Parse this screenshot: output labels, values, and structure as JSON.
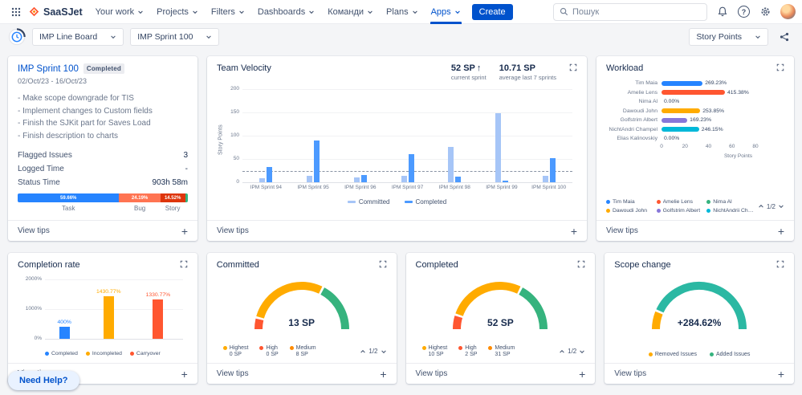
{
  "topnav": {
    "logo_text": "SaaSJet",
    "items": [
      {
        "label": "Your work",
        "active": false
      },
      {
        "label": "Projects",
        "active": false
      },
      {
        "label": "Filters",
        "active": false
      },
      {
        "label": "Dashboards",
        "active": false
      },
      {
        "label": "Команди",
        "active": false
      },
      {
        "label": "Plans",
        "active": false
      },
      {
        "label": "Apps",
        "active": true
      }
    ],
    "create_label": "Create",
    "search_placeholder": "Пошук",
    "help_glyph": "?"
  },
  "toolbar": {
    "board_select": "IMP Line Board",
    "sprint_select": "IMP Sprint 100",
    "metric_select": "Story Points"
  },
  "labels": {
    "view_tips": "View tips",
    "plus": "+",
    "need_help": "Need Help?"
  },
  "cards": {
    "sprint": {
      "title": "IMP Sprint 100",
      "badge": "Completed",
      "dates": "02/Oct/23 - 16/Oct/23",
      "goals": [
        "- Make scope downgrade for TIS",
        "- Implement changes to Custom fields",
        "- Finish the SJKit part for Saves Load",
        "- Finish description to charts"
      ],
      "stats": [
        {
          "label": "Flagged Issues",
          "value": "3"
        },
        {
          "label": "Logged Time",
          "value": "-"
        },
        {
          "label": "Status Time",
          "value": "903h 58m"
        }
      ],
      "type_bar": {
        "segments": [
          {
            "label": "59.66%",
            "value": 59.66,
            "color": "#2684FF"
          },
          {
            "label": "24.19%",
            "value": 24.19,
            "color": "#FF7452"
          },
          {
            "label": "14.52%",
            "value": 14.52,
            "color": "#DE350B"
          },
          {
            "label": "",
            "value": 1.63,
            "color": "#36B37E"
          }
        ],
        "type_labels": [
          "Task",
          "Bug",
          "Story"
        ]
      }
    },
    "velocity": {
      "title": "Team Velocity",
      "current": {
        "value": "52 SP",
        "arrow": "↑",
        "caption": "current sprint"
      },
      "average": {
        "value": "10.71 SP",
        "caption": "average last 7 sprints"
      },
      "chart_data": {
        "type": "bar",
        "categories": [
          "IPM Sprint 94",
          "IPM Sprint 95",
          "IPM Sprint 96",
          "IPM Sprint 97",
          "IPM Sprint 98",
          "IPM Sprint 99",
          "IPM Sprint 100"
        ],
        "series": [
          {
            "name": "Committed",
            "color": "#A6C5F7",
            "values": [
              8,
              13,
              10,
              13,
              76,
              148,
              13
            ]
          },
          {
            "name": "Completed",
            "color": "#4C9AFF",
            "values": [
              33,
              90,
              15,
              60,
              12,
              4,
              52
            ]
          }
        ],
        "ylabel": "Story Points",
        "yticks": [
          0,
          50,
          100,
          150,
          200
        ],
        "ylim": [
          0,
          200
        ],
        "average_line": 25,
        "legend_position": "bottom"
      }
    },
    "workload": {
      "title": "Workload",
      "chart_data": {
        "type": "bar-horizontal",
        "xlabel": "Story Points",
        "xticks": [
          0,
          20,
          40,
          60,
          80
        ],
        "xlim": [
          0,
          80
        ],
        "rows": [
          {
            "name": "Tim Maia",
            "label": "269.23%",
            "sp": 35,
            "color": "#2684FF"
          },
          {
            "name": "Amelie Lens",
            "label": "415.38%",
            "sp": 54,
            "color": "#FF5630"
          },
          {
            "name": "Nima Al",
            "label": "0.00%",
            "sp": 0,
            "color": "#36B37E"
          },
          {
            "name": "Dawoudi John",
            "label": "253.85%",
            "sp": 33,
            "color": "#FFAB00"
          },
          {
            "name": "Golfstrim Albert",
            "label": "169.23%",
            "sp": 22,
            "color": "#8777D9"
          },
          {
            "name": "NichtAndri Champel",
            "label": "246.15%",
            "sp": 32,
            "color": "#00B8D9"
          },
          {
            "name": "Elias Kalinovskiy",
            "label": "0.00%",
            "sp": 0,
            "color": "#6B778C"
          }
        ]
      },
      "legend": [
        {
          "name": "Tim Maia",
          "color": "#2684FF"
        },
        {
          "name": "Amelie Lens",
          "color": "#FF5630"
        },
        {
          "name": "Nima Al",
          "color": "#36B37E"
        },
        {
          "name": "Dawoudi John",
          "color": "#FFAB00"
        },
        {
          "name": "Golfstrim Albert",
          "color": "#8777D9"
        },
        {
          "name": "NichtAndrii Champel",
          "color": "#00B8D9"
        }
      ],
      "pagination": "1/2"
    },
    "completion": {
      "title": "Completion rate",
      "chart_data": {
        "type": "bar",
        "categories": [
          "Completed",
          "Incompleted",
          "Carryover"
        ],
        "values": [
          400,
          1430.77,
          1330.77
        ],
        "value_labels": [
          "400%",
          "1430.77%",
          "1330.77%"
        ],
        "colors": [
          "#2684FF",
          "#FFAB00",
          "#FF5630"
        ],
        "yticks": [
          {
            "label": "0%",
            "value": 0
          },
          {
            "label": "1000%",
            "value": 1000
          },
          {
            "label": "2000%",
            "value": 2000
          }
        ],
        "ylim": [
          0,
          2000
        ]
      },
      "legend": [
        {
          "name": "Completed",
          "color": "#2684FF"
        },
        {
          "name": "Incompleted",
          "color": "#FFAB00"
        },
        {
          "name": "Carryover",
          "color": "#FF5630"
        }
      ]
    },
    "committed": {
      "title": "Committed",
      "value": "13 SP",
      "chart_data": {
        "type": "gauge",
        "value_label": "13 SP",
        "segments": [
          {
            "color": "#FF5630",
            "frac": 0.08
          },
          {
            "color": "#FFAB00",
            "frac": 0.57
          },
          {
            "color": "#36B37E",
            "frac": 0.35
          }
        ]
      },
      "legend": [
        {
          "name": "Highest",
          "value": "0 SP",
          "color": "#FFAB00"
        },
        {
          "name": "High",
          "value": "0 SP",
          "color": "#FF5630"
        },
        {
          "name": "Medium",
          "value": "8 SP",
          "color": "#FF8B00"
        }
      ],
      "pagination": "1/2"
    },
    "completed": {
      "title": "Completed",
      "value": "52 SP",
      "chart_data": {
        "type": "gauge",
        "value_label": "52 SP",
        "segments": [
          {
            "color": "#FF5630",
            "frac": 0.1
          },
          {
            "color": "#FFAB00",
            "frac": 0.55
          },
          {
            "color": "#36B37E",
            "frac": 0.35
          }
        ]
      },
      "legend": [
        {
          "name": "Highest",
          "value": "10 SP",
          "color": "#FFAB00"
        },
        {
          "name": "High",
          "value": "2 SP",
          "color": "#FF5630"
        },
        {
          "name": "Medium",
          "value": "31 SP",
          "color": "#FF8B00"
        }
      ],
      "pagination": "1/2"
    },
    "scope": {
      "title": "Scope change",
      "value": "+284.62%",
      "chart_data": {
        "type": "gauge",
        "value_label": "+284.62%",
        "segments": [
          {
            "color": "#FFAB00",
            "frac": 0.13
          },
          {
            "color": "#2BB8A3",
            "frac": 0.87
          }
        ]
      },
      "legend": [
        {
          "name": "Removed Issues",
          "color": "#FFAB00"
        },
        {
          "name": "Added Issues",
          "color": "#36B37E"
        }
      ]
    }
  }
}
